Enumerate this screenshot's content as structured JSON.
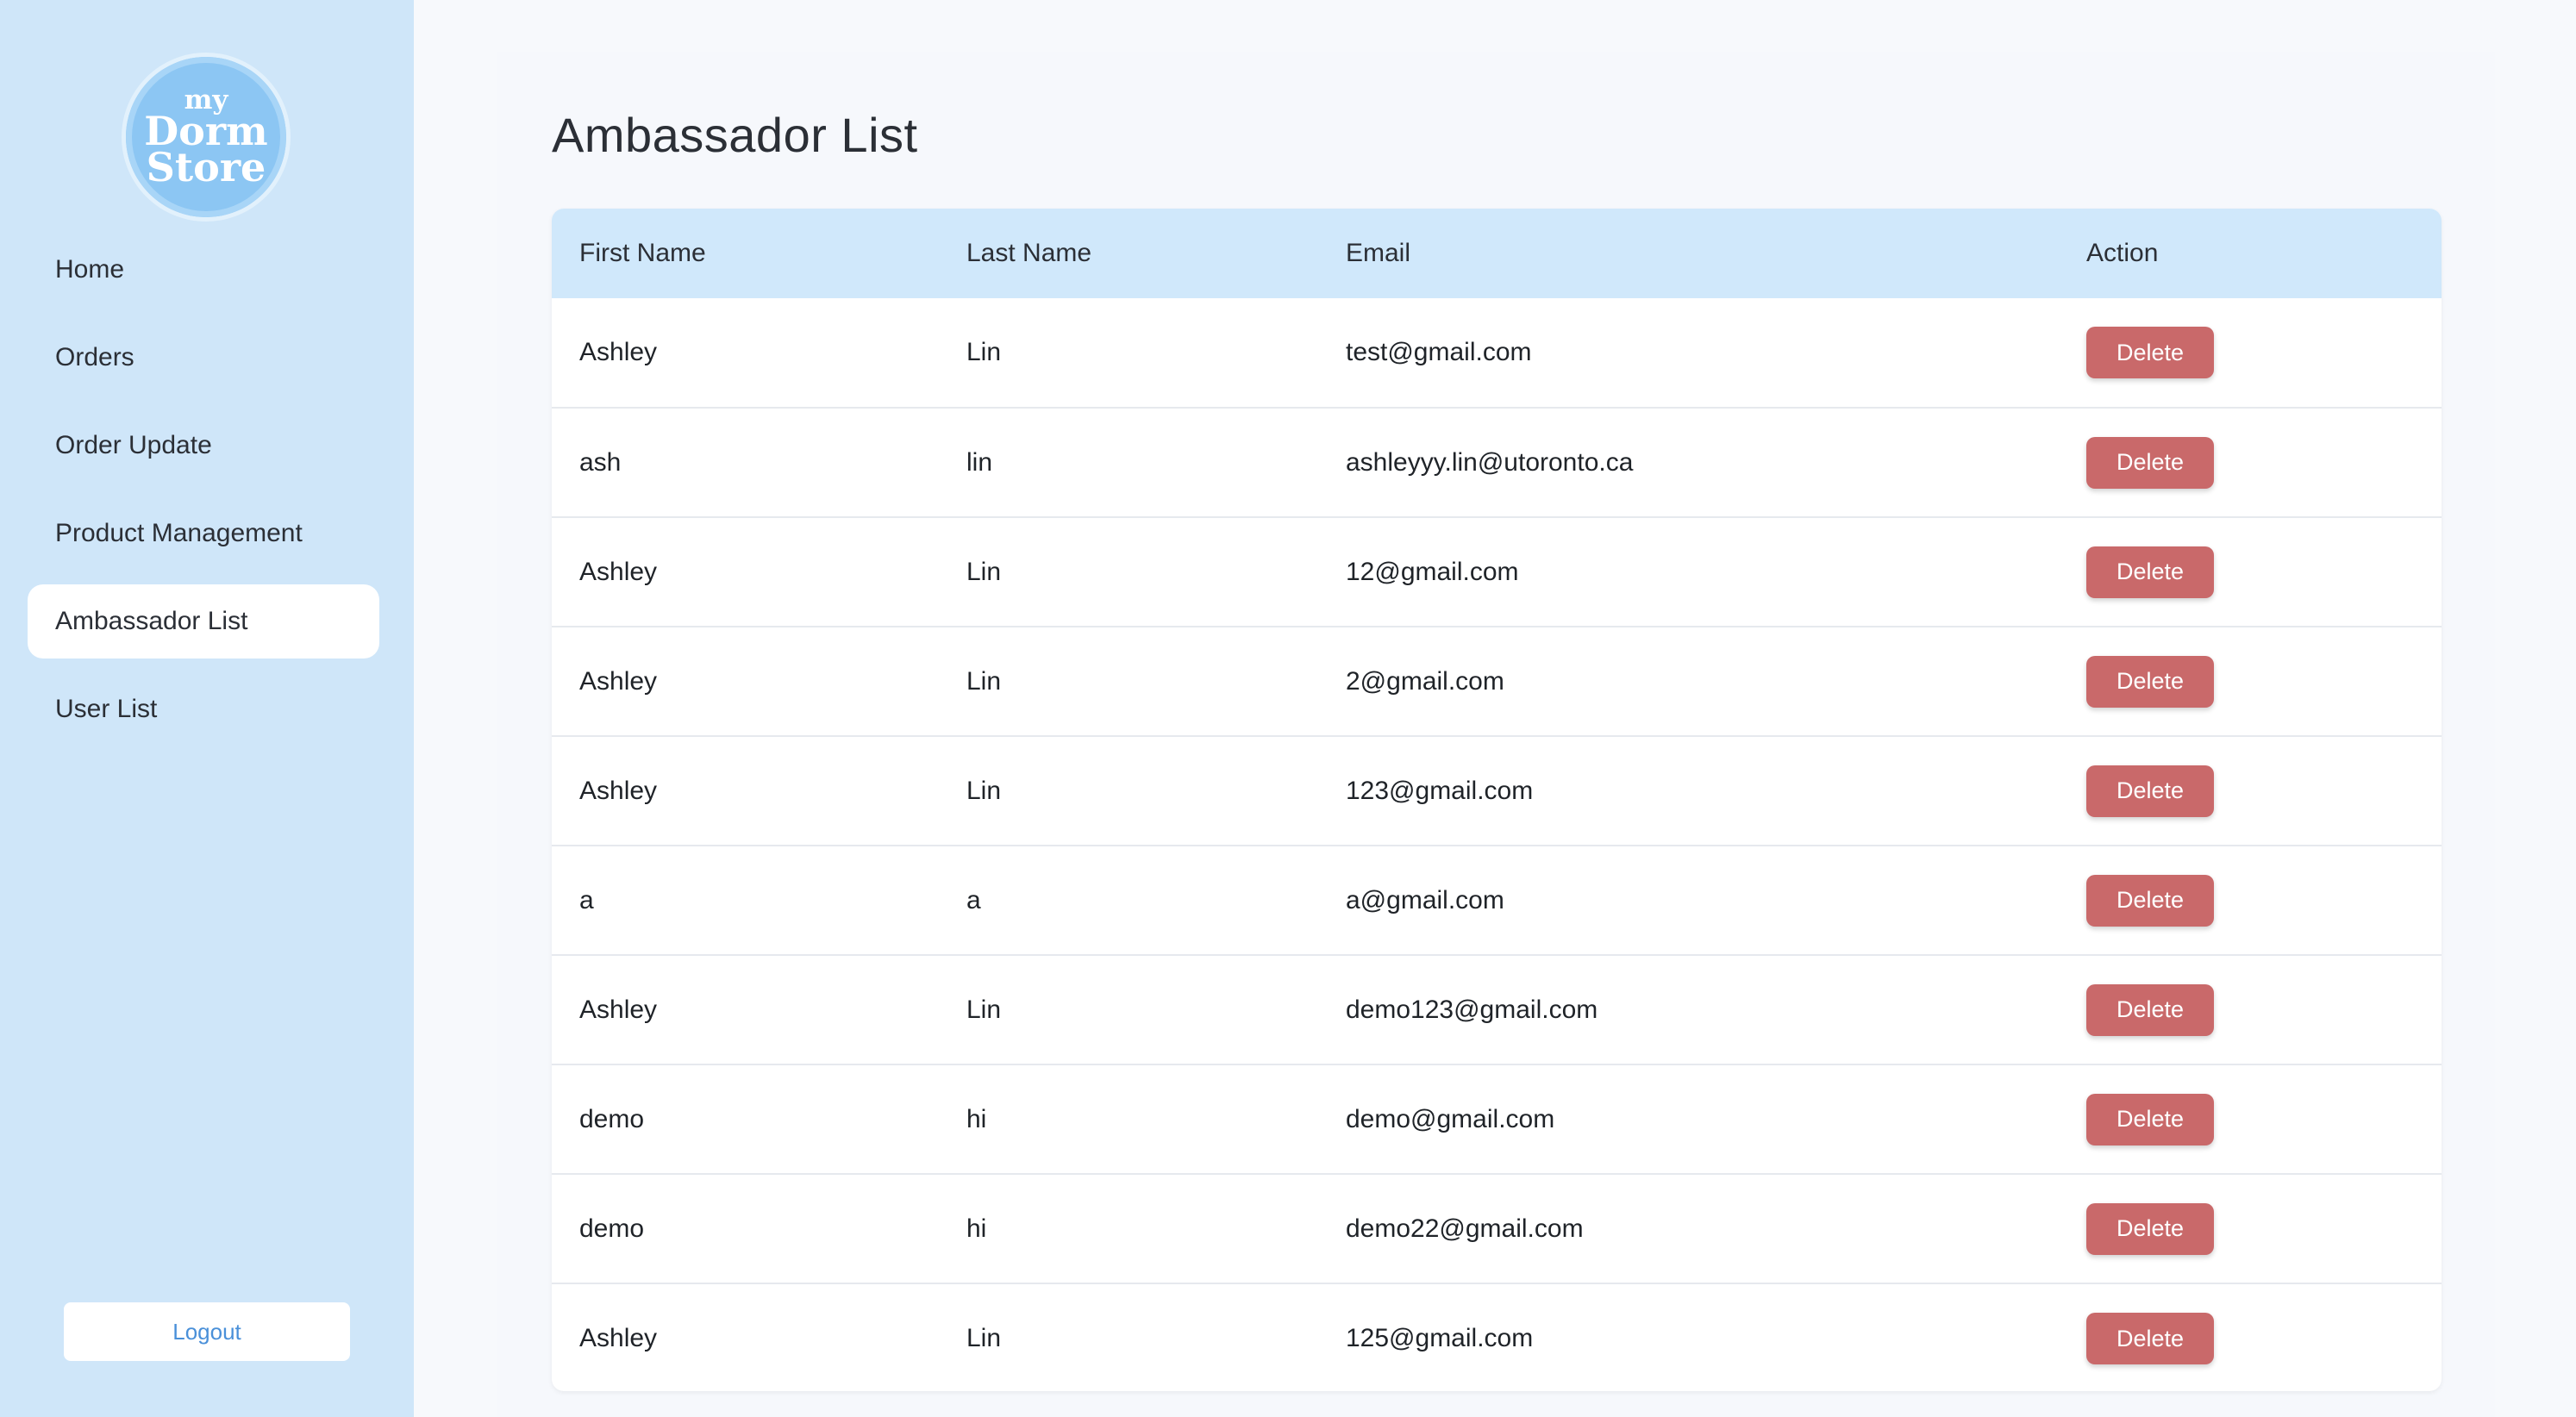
{
  "logo": {
    "line1": "my",
    "line2": "Dorm",
    "line3": "Store"
  },
  "sidebar": {
    "items": [
      {
        "label": "Home"
      },
      {
        "label": "Orders"
      },
      {
        "label": "Order Update"
      },
      {
        "label": "Product Management"
      },
      {
        "label": "Ambassador List",
        "active": true
      },
      {
        "label": "User List"
      }
    ],
    "logout_label": "Logout"
  },
  "page": {
    "title": "Ambassador List"
  },
  "table": {
    "columns": [
      "First Name",
      "Last Name",
      "Email",
      "Action"
    ],
    "rows": [
      {
        "first": "Ashley",
        "last": "Lin",
        "email": "test@gmail.com",
        "action": "Delete"
      },
      {
        "first": "ash",
        "last": "lin",
        "email": "ashleyyy.lin@utoronto.ca",
        "action": "Delete"
      },
      {
        "first": "Ashley",
        "last": "Lin",
        "email": "12@gmail.com",
        "action": "Delete"
      },
      {
        "first": "Ashley",
        "last": "Lin",
        "email": "2@gmail.com",
        "action": "Delete"
      },
      {
        "first": "Ashley",
        "last": "Lin",
        "email": "123@gmail.com",
        "action": "Delete"
      },
      {
        "first": "a",
        "last": "a",
        "email": "a@gmail.com",
        "action": "Delete"
      },
      {
        "first": "Ashley",
        "last": "Lin",
        "email": "demo123@gmail.com",
        "action": "Delete"
      },
      {
        "first": "demo",
        "last": "hi",
        "email": "demo@gmail.com",
        "action": "Delete"
      },
      {
        "first": "demo",
        "last": "hi",
        "email": "demo22@gmail.com",
        "action": "Delete"
      },
      {
        "first": "Ashley",
        "last": "Lin",
        "email": "125@gmail.com",
        "action": "Delete"
      }
    ]
  },
  "colors": {
    "sidebar_bg": "#cfe6f9",
    "header_bg": "#d0e8fb",
    "delete_button": "#c9696a",
    "logout_text": "#4a90d9",
    "logo_bg": "#8cc6f3"
  }
}
